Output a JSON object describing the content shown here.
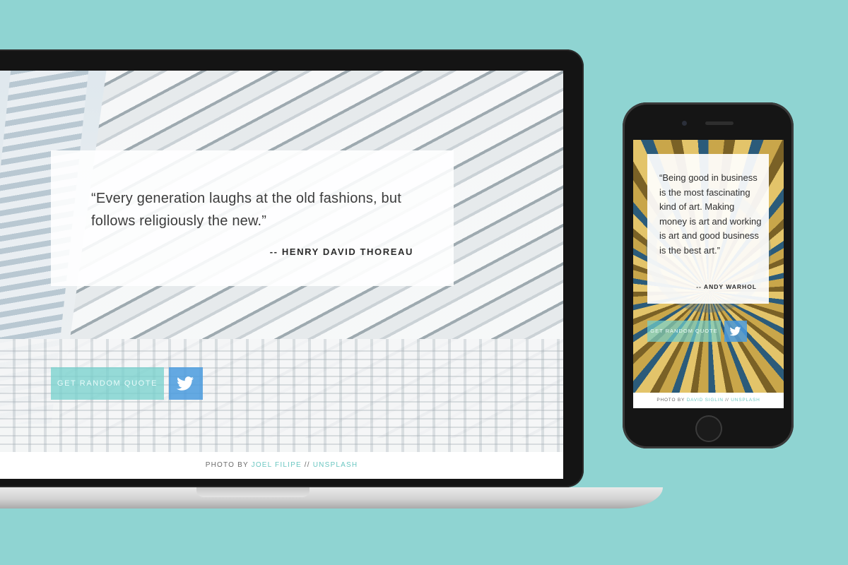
{
  "desktop": {
    "quote": {
      "text": "“Every generation laughs at the old fashions, but follows religiously the new.”",
      "author": "-- HENRY DAVID THOREAU"
    },
    "buttons": {
      "random_quote": "GET RANDOM QUOTE",
      "tweet_icon": "twitter-bird-icon"
    },
    "footer": {
      "prefix": "PHOTO BY",
      "photographer": "JOEL FILIPE",
      "separator": "//",
      "source": "UNSPLASH"
    }
  },
  "mobile": {
    "quote": {
      "text": "“Being good in business is the most fascinating kind of art. Making money is art and working is art and good business is the best art.”",
      "author": "-- ANDY WARHOL"
    },
    "buttons": {
      "random_quote": "GET RANDOM QUOTE",
      "tweet_icon": "twitter-bird-icon"
    },
    "footer": {
      "prefix": "PHOTO BY",
      "photographer": "DAVID SIGLIN",
      "separator": "//",
      "source": "UNSPLASH"
    }
  },
  "colors": {
    "background": "#8fd4d2",
    "accent_teal": "#74d0cc",
    "twitter_blue": "#4a9bde"
  }
}
